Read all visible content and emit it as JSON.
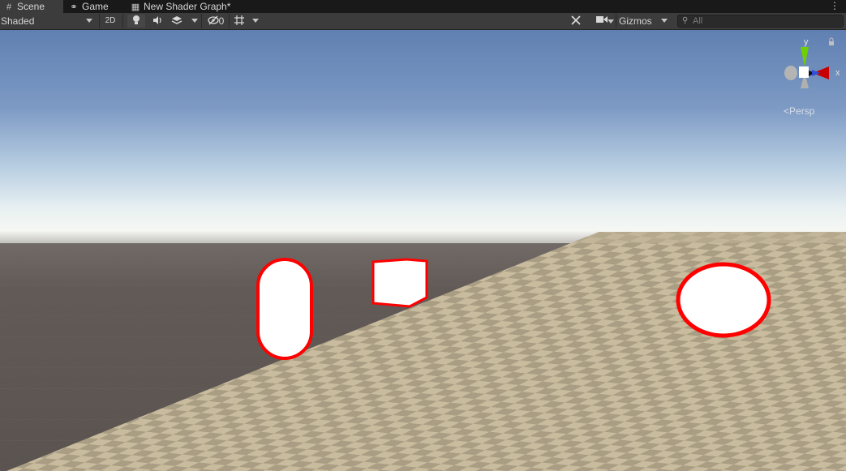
{
  "tabs": [
    {
      "label": "Scene",
      "icon": "hash-grid-icon",
      "active": true
    },
    {
      "label": "Game",
      "icon": "gamepad-icon",
      "active": false
    },
    {
      "label": "New Shader Graph*",
      "icon": "shader-graph-icon",
      "active": false
    }
  ],
  "toolbar": {
    "draw_mode": "Shaded",
    "mode_2d": "2D",
    "hidden_count": "0",
    "gizmos_label": "Gizmos",
    "search_placeholder": "All"
  },
  "orientation_gizmo": {
    "y_label": "y",
    "x_label": "x",
    "projection": "Persp"
  },
  "scene_objects": [
    {
      "name": "capsule",
      "outline_color": "#ff0000"
    },
    {
      "name": "cube",
      "outline_color": "#ff0000"
    },
    {
      "name": "sphere",
      "outline_color": "#ff0000"
    }
  ],
  "colors": {
    "selection_outline": "#ff0000",
    "sky_top": "#6483b4",
    "horizon": "#f2f5f2",
    "ground_dark": "#5e5753",
    "checker_light": "#c4b89c",
    "checker_dark": "#a99e84"
  }
}
